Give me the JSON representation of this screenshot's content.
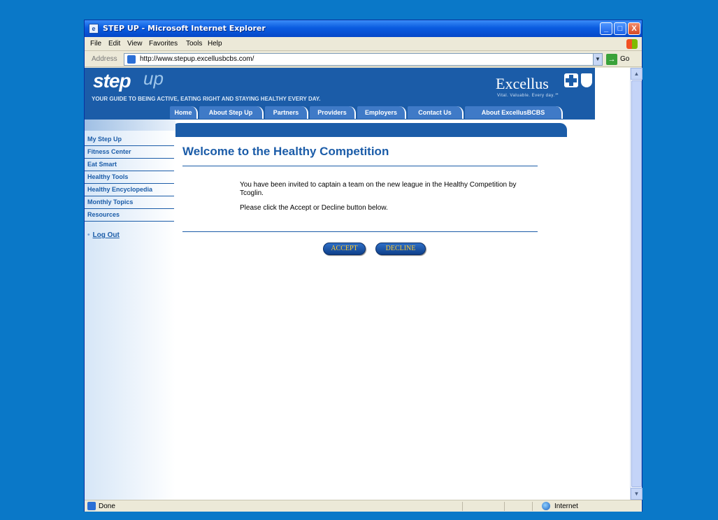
{
  "window": {
    "title": "STEP UP - Microsoft Internet Explorer",
    "controls": [
      "_",
      "□",
      "X"
    ]
  },
  "menubar": {
    "items": [
      "File",
      "Edit",
      "View",
      "Favorites",
      "Tools",
      "Help"
    ]
  },
  "addressbar": {
    "label": "Address",
    "url": "http://www.stepup.excellusbcbs.com/",
    "go_label": "Go"
  },
  "header": {
    "logo_step": "step",
    "logo_up": "up",
    "tagline": "YOUR GUIDE TO BEING ACTIVE, EATING RIGHT AND STAYING HEALTHY EVERY DAY.",
    "brand": "Excellus",
    "brand_tag": "Vital. Valuable. Every day.℠"
  },
  "nav": {
    "tabs": [
      "Home",
      "About Step Up",
      "Partners",
      "Providers",
      "Employers",
      "Contact Us",
      "About ExcellusBCBS"
    ]
  },
  "sidebar": {
    "items": [
      "My Step Up",
      "Fitness Center",
      "Eat Smart",
      "Healthy Tools",
      "Healthy Encyclopedia",
      "Monthly Topics",
      "Resources"
    ],
    "logout_bullet": "•",
    "logout": "Log Out"
  },
  "main": {
    "title": "Welcome to the Healthy Competition",
    "message_line1": "You have been invited to captain a team on the new league in the Healthy Competition by Tcoglin.",
    "message_line2": "Please click the Accept or Decline button below.",
    "accept_label": "ACCEPT",
    "decline_label": "DECLINE"
  },
  "statusbar": {
    "text": "Done",
    "zone": "Internet"
  },
  "colors": {
    "desktop": "#0a78c8",
    "brand_blue": "#1b5ca8",
    "button_text": "#ffcc33"
  }
}
